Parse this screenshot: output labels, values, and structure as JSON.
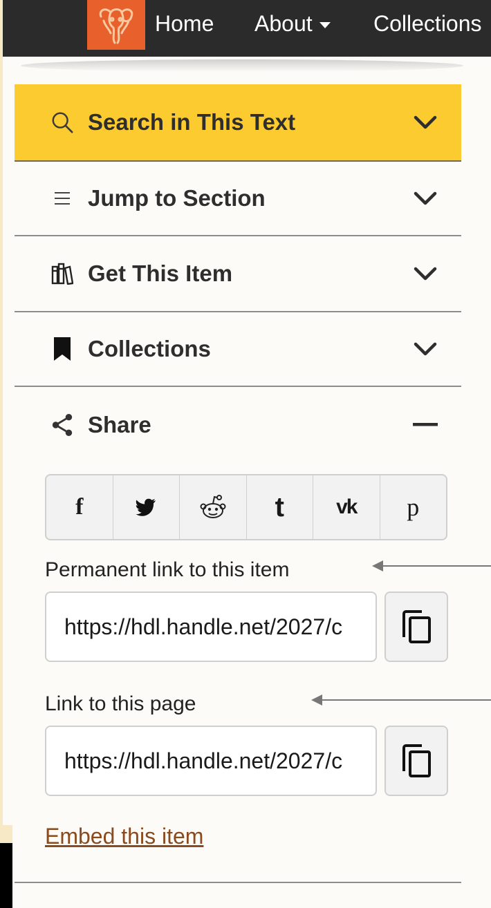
{
  "nav": {
    "logo_icon": "elephant-logo-icon",
    "items": [
      {
        "label": "Home"
      },
      {
        "label": "About",
        "icon": "caret-down-icon"
      },
      {
        "label": "Collections"
      }
    ]
  },
  "sidebar": {
    "sections": [
      {
        "label": "Search in This Text",
        "icon": "search-icon",
        "toggle": "chevron-down-icon",
        "active": true
      },
      {
        "label": "Jump to Section",
        "icon": "list-icon",
        "toggle": "chevron-down-icon"
      },
      {
        "label": "Get This Item",
        "icon": "books-icon",
        "toggle": "chevron-down-icon"
      },
      {
        "label": "Collections",
        "icon": "bookmark-icon",
        "toggle": "chevron-down-icon"
      },
      {
        "label": "Share",
        "icon": "share-icon",
        "toggle": "minus-icon",
        "expanded": true
      }
    ]
  },
  "share": {
    "buttons": [
      {
        "glyph": "f",
        "icon": "facebook-icon"
      },
      {
        "glyph": "",
        "icon": "twitter-icon"
      },
      {
        "glyph": "",
        "icon": "reddit-icon"
      },
      {
        "glyph": "t",
        "icon": "tumblr-icon"
      },
      {
        "glyph": "vk",
        "icon": "vk-icon"
      },
      {
        "glyph": "p",
        "icon": "pinterest-icon"
      }
    ],
    "permanent_link_label": "Permanent link to this item",
    "permanent_link_value": "https://hdl.handle.net/2027/c",
    "page_link_label": "Link to this page",
    "page_link_value": "https://hdl.handle.net/2027/c",
    "copy_icon": "copy-icon",
    "embed_label": "Embed this item"
  },
  "colors": {
    "accent": "#fccb2f",
    "topbar": "#2b2b2b",
    "logo_bg": "#e8612c",
    "link": "#8a4a1e",
    "page_bg": "#f7e9c6"
  }
}
